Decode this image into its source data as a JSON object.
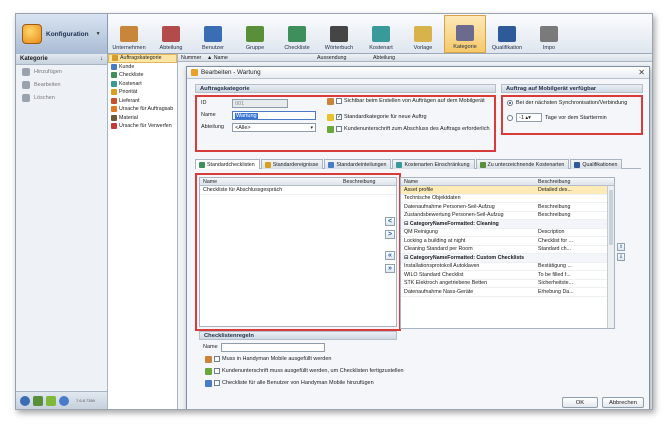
{
  "app": {
    "title": "Konfiguration"
  },
  "ribbon": [
    {
      "label": "Unternehmen",
      "color": "#c9853a"
    },
    {
      "label": "Abteilung",
      "color": "#b44b4b"
    },
    {
      "label": "Benutzer",
      "color": "#3b6db5"
    },
    {
      "label": "Gruppe",
      "color": "#5a8f3a"
    },
    {
      "label": "Checkliste",
      "color": "#3e8f5b"
    },
    {
      "label": "Wörterbuch",
      "color": "#454545"
    },
    {
      "label": "Kostenart",
      "color": "#3a9a9a"
    },
    {
      "label": "Vorlage",
      "color": "#d8b24a"
    },
    {
      "label": "Kategorie",
      "color": "#6b6b8f",
      "active": true
    },
    {
      "label": "Qualifikation",
      "color": "#2f5a9a"
    },
    {
      "label": "Impo",
      "color": "#7a7a7a"
    }
  ],
  "nav": {
    "header": "Kategorie",
    "pin": "↓",
    "items": [
      {
        "label": "Hinzufügen",
        "icon": "add-icon"
      },
      {
        "label": "Bearbeiten",
        "icon": "edit-icon"
      },
      {
        "label": "Löschen",
        "icon": "delete-icon"
      }
    ],
    "version": "7.6.8.7359"
  },
  "categories": [
    {
      "label": "Auftragskategorie",
      "color": "#d89a2a",
      "selected": true
    },
    {
      "label": "Kunde",
      "color": "#4a7bc8"
    },
    {
      "label": "Checkliste",
      "color": "#3e8f5b"
    },
    {
      "label": "Kostenart",
      "color": "#3a9a9a"
    },
    {
      "label": "Priorität",
      "color": "#d8a020"
    },
    {
      "label": "Lieferant",
      "color": "#c8502a"
    },
    {
      "label": "Ursache für Auftragsab",
      "color": "#e07a20"
    },
    {
      "label": "Material",
      "color": "#6a5a3a"
    },
    {
      "label": "Ursache für Verwerfen",
      "color": "#c83a3a"
    }
  ],
  "grid": {
    "col_nummer": "Nummer",
    "col_name": "▲ Name",
    "col_aussendung": "Aussendung",
    "col_abteilung": "Abteilung"
  },
  "dialog": {
    "title": "Bearbeiten - Wartung",
    "close": "✕",
    "section_order": "Auftragskategorie",
    "id_label": "ID",
    "id_value": "001",
    "name_label": "Name",
    "name_value": "Wartung",
    "dept_label": "Abteilung",
    "dept_value": "<Alle>",
    "chk_visible": "Sichtbar beim Erstellen von Aufträgen auf dem Mobilgerät",
    "chk_default": "Standardkategorie für neue Auftrg",
    "chk_signature": "Kundenunterschrift zum Abschluss des Auftrags erforderlich",
    "section_mobile": "Auftrag auf Mobilgerät verfügbar",
    "radio_next_sync": "Bei der nächsten Synchronisation/Verbindung",
    "radio_days_value": "-1",
    "radio_days_label": "Tage vor dem Starttermin",
    "tabs": [
      {
        "label": "Standardchecklisten",
        "color": "#3e8f5b",
        "active": true
      },
      {
        "label": "Standardereignisse",
        "color": "#d8a020"
      },
      {
        "label": "Standardeinteilungen",
        "color": "#4a7bc8"
      },
      {
        "label": "Kostenarten Einschränkung",
        "color": "#3a9a9a"
      },
      {
        "label": "Zu unterzeichnende Kostenarten",
        "color": "#5a8f3a"
      },
      {
        "label": "Qualifikationen",
        "color": "#2f5a9a"
      }
    ],
    "left_list": {
      "col_name": "Name",
      "col_desc": "Beschreibung",
      "rows": [
        {
          "name": "Checkliste für Abschlussgespräch",
          "desc": ""
        }
      ]
    },
    "arrows": {
      "add": "<",
      "remove": ">",
      "add_all": "«",
      "remove_all": "»"
    },
    "right_list": {
      "col_name": "Name",
      "col_desc": "Beschreibung",
      "rows": [
        {
          "name": "Asset profile",
          "desc": "Detailed des...",
          "selected": true
        },
        {
          "name": "Technische Objektdaten",
          "desc": ""
        },
        {
          "name": "Datenaufnahme Personen-Seil-Aufzug",
          "desc": "Beschreibung"
        },
        {
          "name": "Zustandsbewertung Personen-Seil-Aufzug",
          "desc": "Beschreibung"
        },
        {
          "name": "⊟ CategoryNameFormatted: Cleaning",
          "desc": "",
          "group": true
        },
        {
          "name": "QM Reinigung",
          "desc": "Description"
        },
        {
          "name": "Locking a building at night",
          "desc": "Checklist for ..."
        },
        {
          "name": "Cleaning Standard per Room",
          "desc": "Standard ch..."
        },
        {
          "name": "⊟ CategoryNameFormatted: Custom Checklists",
          "desc": "",
          "group": true
        },
        {
          "name": "Installationsprotokoll Autoklaven",
          "desc": "Bestätigung ..."
        },
        {
          "name": "WILO Standard Checklist",
          "desc": "To be filled f..."
        },
        {
          "name": "STK Elektroch angetriebene Betten",
          "desc": "Sicherheitste..."
        },
        {
          "name": "Datenaufnahme Nass-Geräte",
          "desc": "Erhebung Da..."
        }
      ]
    },
    "section_rules": "Checklistenregeln",
    "rules_name_label": "Name",
    "rules_name_value": "",
    "rule_1": "Muss in Handyman Mobile ausgefüllt werden",
    "rule_2": "Kundenunterschrift muss ausgefüllt werden, um Checklisten fertigzustellen",
    "rule_3": "Checkliste für alle Benutzer von Handyman Mobile hinzufügen",
    "ok": "OK",
    "cancel": "Abbrechen"
  }
}
